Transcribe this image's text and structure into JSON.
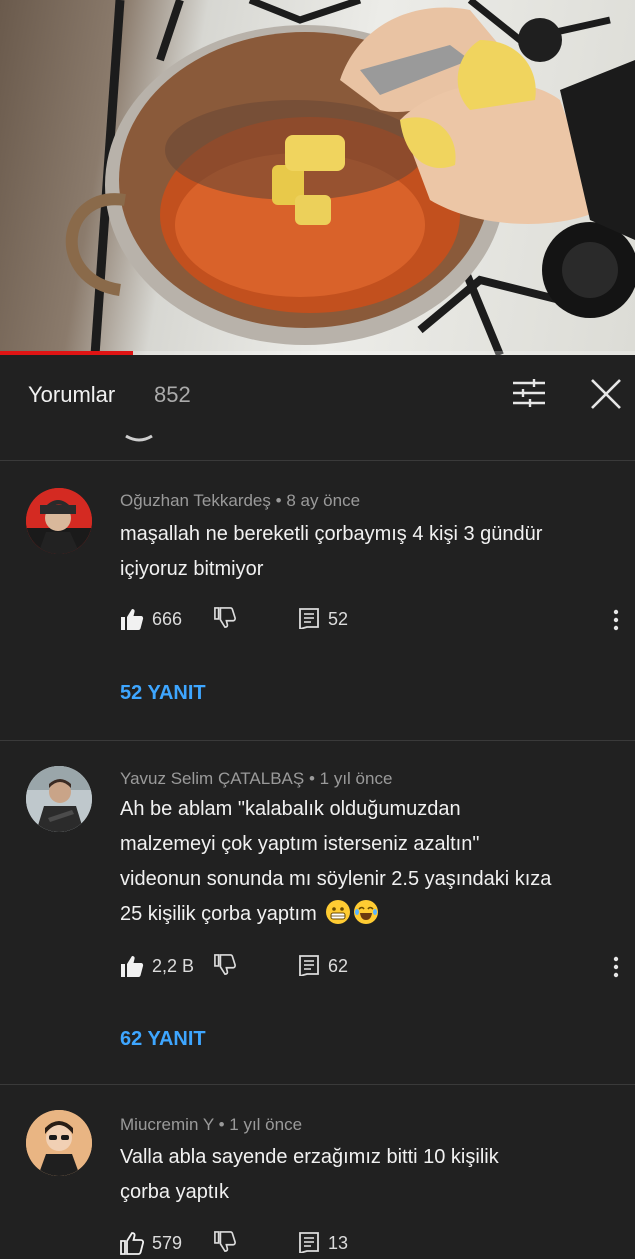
{
  "video": {
    "progress": 0.21
  },
  "header": {
    "title": "Yorumlar",
    "count": "852"
  },
  "comments": [
    {
      "author": "Oğuzhan Tekkardeş",
      "time": "8 ay önce",
      "lines": [
        "maşallah ne bereketli çorbaymış 4 kişi 3 gündür",
        "içiyoruz bitmiyor"
      ],
      "likes": "666",
      "replies_count": "52",
      "reply_link": "52 YANIT"
    },
    {
      "author": "Yavuz Selim ÇATALBAŞ",
      "time": "1 yıl önce",
      "lines": [
        "Ah be ablam \"kalabalık olduğumuzdan",
        "malzemeyi çok yaptım isterseniz azaltın\"",
        "videonun sonunda mı söylenir 2.5 yaşındaki kıza",
        "25 kişilik çorba yaptım"
      ],
      "likes": "2,2 B",
      "replies_count": "62",
      "reply_link": "62 YANIT"
    },
    {
      "author": "Miucremin Y",
      "time": "1 yıl önce",
      "lines": [
        "Valla abla sayende erzağımız bitti 10 kişilik",
        "çorba yaptık"
      ],
      "likes": "579",
      "replies_count": "13"
    }
  ],
  "icons": {
    "filter": "filter-icon",
    "close": "close-icon",
    "like": "thumbs-up-icon",
    "dislike": "thumbs-down-icon",
    "reply": "reply-icon",
    "more": "more-vert-icon",
    "emoji": [
      "grimacing-face-emoji",
      "laughing-tears-emoji"
    ]
  },
  "colors": {
    "background": "#212121",
    "accent_link": "#3ea6ff",
    "progress": "#e01414"
  }
}
